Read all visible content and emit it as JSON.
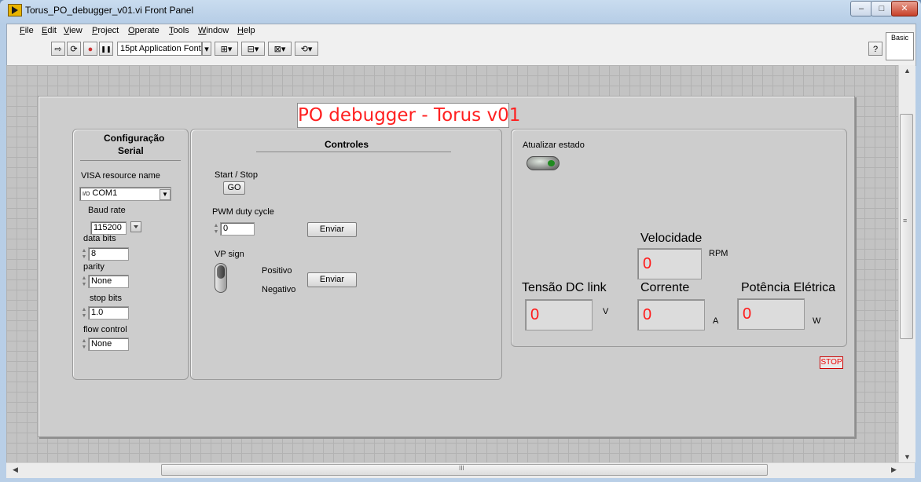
{
  "window": {
    "title": "Torus_PO_debugger_v01.vi Front Panel",
    "controls": {
      "minimize": "–",
      "maximize": "□",
      "close": "✕"
    }
  },
  "menu": [
    {
      "label": "File",
      "u": "F",
      "rest": "ile"
    },
    {
      "label": "Edit",
      "u": "E",
      "rest": "dit"
    },
    {
      "label": "View",
      "u": "V",
      "rest": "iew"
    },
    {
      "label": "Project",
      "u": "P",
      "rest": "roject"
    },
    {
      "label": "Operate",
      "u": "O",
      "rest": "perate"
    },
    {
      "label": "Tools",
      "u": "T",
      "rest": "ools"
    },
    {
      "label": "Window",
      "u": "W",
      "rest": "indow"
    },
    {
      "label": "Help",
      "u": "H",
      "rest": "elp"
    }
  ],
  "toolbar": {
    "run": "⇨",
    "run_continuous": "⟳",
    "abort": "●",
    "pause": "❚❚",
    "font": "15pt Application Font",
    "font_arrow": "▾",
    "align": "⊞▾",
    "distribute": "⊟▾",
    "resize": "⊠▾",
    "reorder": "⟲▾",
    "basic_label": "Basic",
    "help": "?"
  },
  "panel": {
    "title": "PO debugger - Torus v01",
    "serial": {
      "heading_line1": "Configuração",
      "heading_line2": "Serial",
      "visa_label": "VISA resource name",
      "visa_icon": "I/O",
      "visa_value": "COM1",
      "baud_label": "Baud rate",
      "baud_value": "115200",
      "data_bits_label": "data bits",
      "data_bits_value": "8",
      "parity_label": "parity",
      "parity_value": "None",
      "stop_bits_label": "stop bits",
      "stop_bits_value": "1.0",
      "flow_label": "flow control",
      "flow_value": "None"
    },
    "controls": {
      "heading": "Controles",
      "start_stop_label": "Start / Stop",
      "go_label": "GO",
      "pwm_label": "PWM duty cycle",
      "pwm_value": "0",
      "send_label": "Enviar",
      "vp_sign_label": "VP sign",
      "positive_label": "Positivo",
      "negative_label": "Negativo"
    },
    "status": {
      "update_label": "Atualizar estado",
      "velocity_label": "Velocidade",
      "velocity_value": "0",
      "velocity_unit": "RPM",
      "voltage_label": "Tensão DC link",
      "voltage_value": "0",
      "voltage_unit": "V",
      "current_label": "Corrente",
      "current_value": "0",
      "current_unit": "A",
      "power_label": "Potência Elétrica",
      "power_value": "0",
      "power_unit": "W"
    },
    "stop_label": "STOP"
  },
  "scroll": {
    "h_grip": "III",
    "v_grip": "≡"
  }
}
